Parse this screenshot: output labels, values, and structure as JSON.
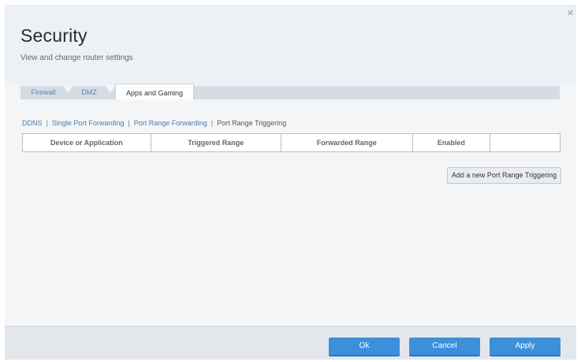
{
  "header": {
    "title": "Security",
    "subtitle": "View and change router settings"
  },
  "close_icon": "close-icon",
  "tabs": [
    {
      "label": "Firewall",
      "active": false
    },
    {
      "label": "DMZ",
      "active": false
    },
    {
      "label": "Apps and Gaming",
      "active": true
    }
  ],
  "sublinks": [
    {
      "label": "DDNS",
      "current": false
    },
    {
      "label": "Single Port Forwarding",
      "current": false
    },
    {
      "label": "Port Range Forwarding",
      "current": false
    },
    {
      "label": "Port Range Triggering",
      "current": true
    }
  ],
  "table": {
    "columns": [
      "Device or Application",
      "Triggered Range",
      "Forwarded Range",
      "Enabled",
      ""
    ]
  },
  "add_button": "Add a new Port Range Triggering",
  "footer": {
    "ok": "Ok",
    "cancel": "Cancel",
    "apply": "Apply"
  },
  "colors": {
    "accent": "#3d8fdc",
    "link": "#4a7bb0"
  }
}
